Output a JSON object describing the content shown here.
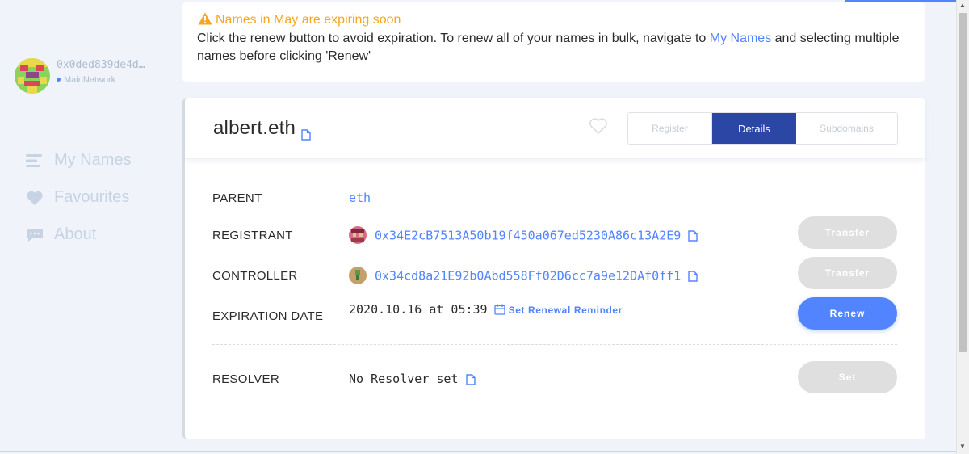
{
  "account": {
    "address": "0x0ded839de4d…",
    "network": "MainNetwork"
  },
  "nav": {
    "items": [
      {
        "label": "My Names",
        "icon": "list-icon"
      },
      {
        "label": "Favourites",
        "icon": "heart-icon"
      },
      {
        "label": "About",
        "icon": "chat-icon"
      }
    ]
  },
  "banner": {
    "title": "Names in May are expiring soon",
    "text_before": "Click the renew button to avoid expiration. To renew all of your names in bulk, navigate to ",
    "link": "My Names",
    "text_after": " and selecting multiple names before clicking 'Renew'"
  },
  "domain": {
    "name": "albert.eth",
    "tabs": [
      "Register",
      "Details",
      "Subdomains"
    ],
    "active_tab": "Details"
  },
  "details": {
    "parent_label": "PARENT",
    "parent_value": "eth",
    "registrant_label": "REGISTRANT",
    "registrant_value": "0x34E2cB7513A50b19f450a067ed5230A86c13A2E9",
    "controller_label": "CONTROLLER",
    "controller_value": "0x34cd8a21E92b0Abd558Ff02D6cc7a9e12DAf0ff1",
    "expiration_label": "EXPIRATION DATE",
    "expiration_value": "2020.10.16 at 05:39",
    "reminder_label": "Set Renewal Reminder",
    "resolver_label": "RESOLVER",
    "resolver_value": "No Resolver set"
  },
  "buttons": {
    "transfer": "Transfer",
    "renew": "Renew",
    "set": "Set"
  },
  "colors": {
    "accent": "#5284ff",
    "active_tab": "#2c46a6",
    "warning": "#f5a623",
    "disabled": "#dfdfdf"
  }
}
